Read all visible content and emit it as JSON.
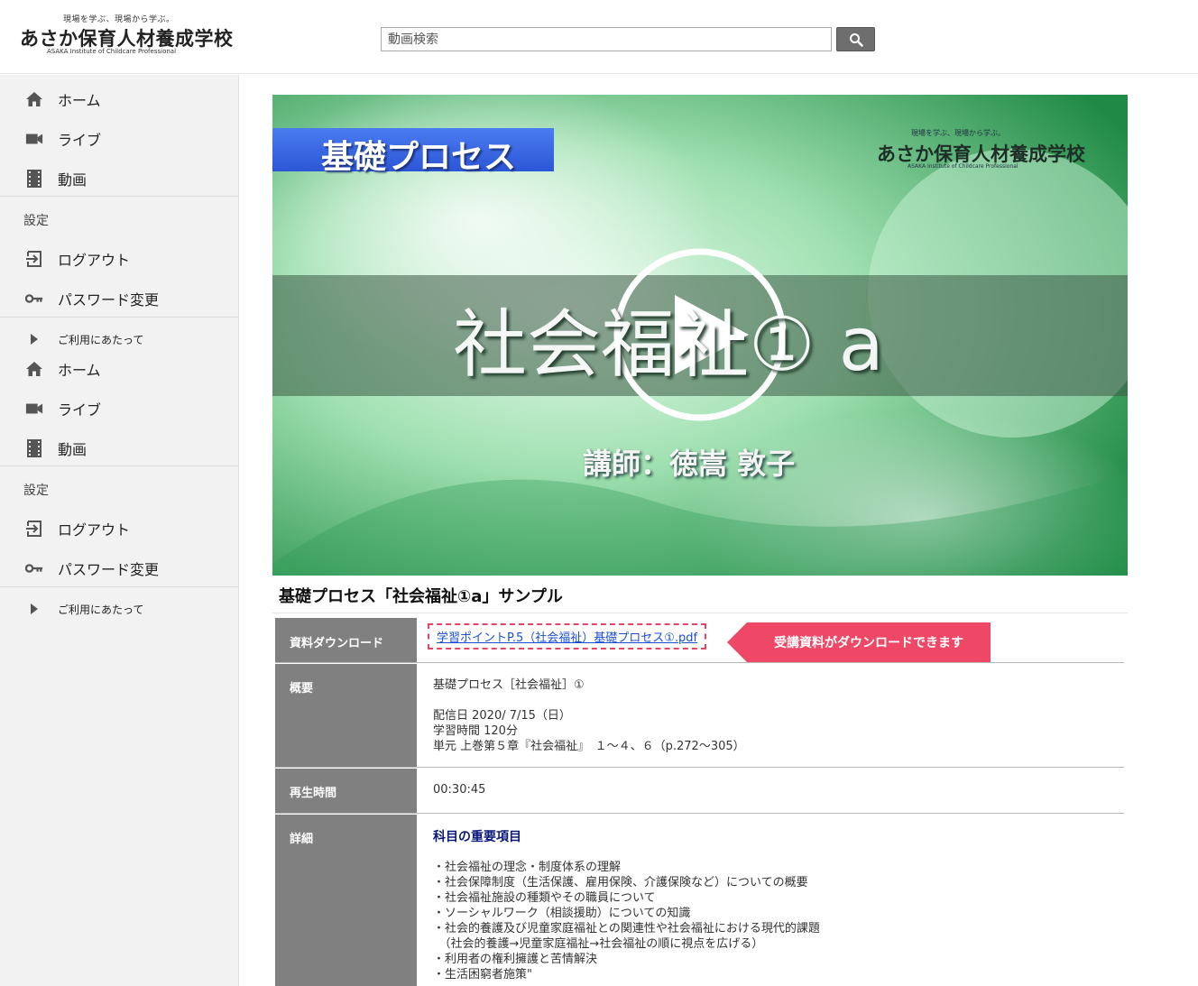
{
  "header": {
    "logo_tagline": "現場を学ぶ、現場から学ぶ。",
    "logo_name": "あさか保育人材養成学校",
    "logo_subtitle": "ASAKA Institute of Childcare Professional",
    "search_placeholder": "動画検索",
    "search_value": ""
  },
  "sidebar": {
    "groups": [
      {
        "items": [
          {
            "label": "ホーム",
            "icon": "home-icon"
          },
          {
            "label": "ライブ",
            "icon": "video-camera-icon"
          },
          {
            "label": "動画",
            "icon": "film-icon"
          }
        ],
        "settings_title": "設定",
        "settings_items": [
          {
            "label": "ログアウト",
            "icon": "logout-icon"
          },
          {
            "label": "パスワード変更",
            "icon": "key-icon"
          }
        ],
        "footer_item": {
          "label": "ご利用にあたって",
          "icon": "play-triangle-icon"
        }
      },
      {
        "items": [
          {
            "label": "ホーム",
            "icon": "home-icon"
          },
          {
            "label": "ライブ",
            "icon": "video-camera-icon"
          },
          {
            "label": "動画",
            "icon": "film-icon"
          }
        ],
        "settings_title": "設定",
        "settings_items": [
          {
            "label": "ログアウト",
            "icon": "logout-icon"
          },
          {
            "label": "パスワード変更",
            "icon": "key-icon"
          }
        ],
        "footer_item": {
          "label": "ご利用にあたって",
          "icon": "play-triangle-icon"
        }
      }
    ]
  },
  "video": {
    "banner": "基礎プロセス",
    "school_tagline": "現場を学ぶ、現場から学ぶ。",
    "school_name": "あさか保育人材養成学校",
    "school_subtitle": "ASAKA Institute of Childcare Professional",
    "main_caption": "社会福祉① a",
    "lecturer": "講師：徳嵩 敦子",
    "play_icon": "play-circle-icon"
  },
  "video_title": "基礎プロセス「社会福祉①a」サンプル",
  "info": {
    "download": {
      "label": "資料ダウンロード",
      "file": "学習ポイントP.5（社会福祉）基礎プロセス①.pdf",
      "badge": "受講資料がダウンロードできます"
    },
    "overview": {
      "label": "概要",
      "line1": "基礎プロセス［社会福祉］①",
      "line2": "配信日 2020/ 7/15（日）",
      "line3": "学習時間 120分",
      "line4": "単元 上巻第５章『社会福祉』　１〜４、６（p.272〜305）"
    },
    "duration": {
      "label": "再生時間",
      "value": "00:30:45"
    },
    "details": {
      "label": "詳細",
      "heading": "科目の重要項目",
      "lines": [
        "・社会福祉の理念・制度体系の理解",
        "・社会保障制度（生活保護、雇用保険、介護保険など）についての概要",
        "・社会福祉施設の種類やその職員について",
        "・ソーシャルワーク（相談援助）についての知識",
        "・社会的養護及び児童家庭福祉との関連性や社会福祉における現代的課題",
        "　（社会的養護→児童家庭福祉→社会福祉の順に視点を広げる）",
        "・利用者の権利擁護と苦情解決",
        "・生活困窮者施策\""
      ]
    }
  },
  "colors": {
    "badge": "#ee4866",
    "sidebar_bg": "#f2f2f2",
    "table_header": "#808080",
    "link": "#1a4fd6",
    "detail_heading": "#0b1a7a"
  }
}
